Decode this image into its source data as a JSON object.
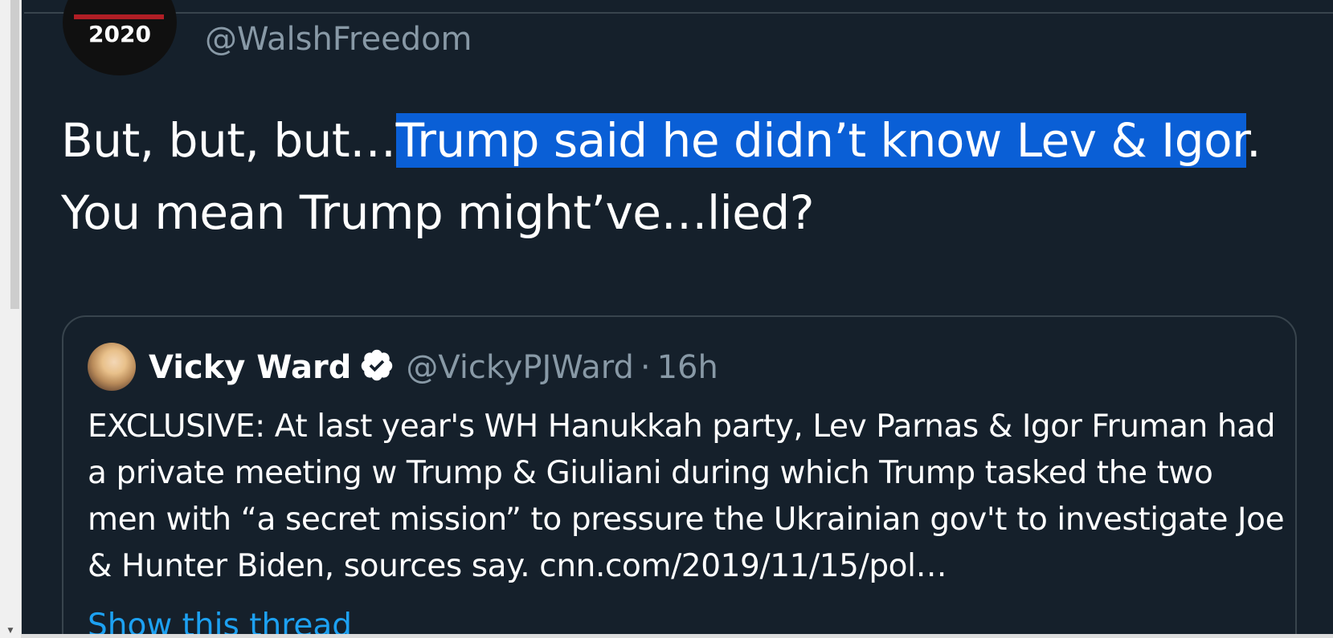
{
  "tweet": {
    "avatar_text": "2020",
    "handle": "@WalshFreedom",
    "text_before_selection": "But, but, but…",
    "text_selected": "Trump said he didn’t know Lev & Igor",
    "text_after_selection": ". You mean Trump might’ve…lied?"
  },
  "quoted_tweet": {
    "name": "Vicky Ward",
    "handle": "@VickyPJWard",
    "separator": "·",
    "time": "16h",
    "body": "EXCLUSIVE: At last year's WH Hanukkah party, Lev Parnas & Igor Fruman had a private meeting w Trump & Giuliani during which Trump tasked the two men with “a secret mission” to pressure the Ukrainian gov't to investigate Joe & Hunter Biden, sources say. cnn.com/2019/11/15/pol…",
    "show_thread": "Show this thread"
  },
  "colors": {
    "background": "#15202b",
    "selection": "#0a5fd6",
    "secondary_text": "#8899a6",
    "link": "#1da1f2",
    "border": "#38444d"
  }
}
